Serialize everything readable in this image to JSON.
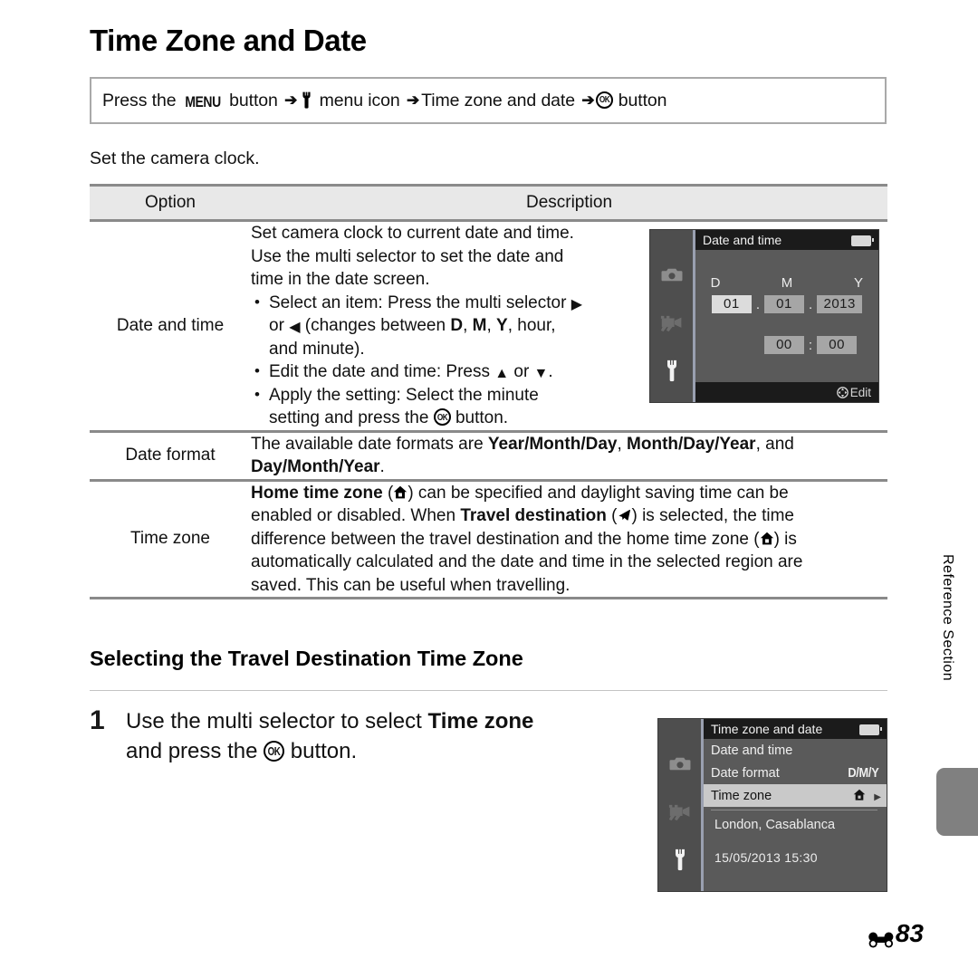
{
  "document": {
    "title": "Time Zone and Date",
    "nav": {
      "parts": [
        "Press the ",
        "MENU",
        " button ",
        "menu icon",
        "Time zone and date",
        " button"
      ],
      "press_the": "Press the ",
      "menu_label": "MENU",
      "button_word": " button ",
      "menu_icon_word": " menu icon ",
      "item": "Time zone and date",
      "ok_button_word": " button"
    },
    "intro": "Set the camera clock.",
    "side_label": "Reference Section",
    "page_number": "83"
  },
  "table": {
    "headers": {
      "option": "Option",
      "description": "Description"
    },
    "rows": [
      {
        "option": "Date and time",
        "lines": [
          "Set camera clock to current date and time.",
          "Use the multi selector to set the date and",
          "time in the date screen."
        ],
        "bullets": [
          {
            "lines": [
              "Select an item: Press the multi selector ▶",
              "or ◀ (changes between D, M, Y, hour,",
              "and minute)."
            ]
          },
          {
            "lines": [
              "Edit the date and time: Press ▲ or ▼."
            ]
          },
          {
            "lines": [
              "Apply the setting: Select the minute",
              "setting and press the OK button."
            ]
          }
        ]
      },
      {
        "option": "Date format",
        "text_parts": {
          "p1": "The available date formats are ",
          "b1": "Year/Month/Day",
          "p2": ", ",
          "b2": "Month/Day/Year",
          "p3": ", and",
          "b3": "Day/Month/Year",
          "p4": "."
        }
      },
      {
        "option": "Time zone",
        "text_parts": {
          "b1": "Home time zone",
          "p1": " (",
          "p2": ") can be specified and daylight saving time can be",
          "p3": "enabled or disabled. When ",
          "b2": "Travel destination",
          "p4": " (",
          "p5": ") is selected, the time",
          "p6": "difference between the travel destination and the home time zone (",
          "p7": ") is",
          "p8": "automatically calculated and the date and time in the selected region are",
          "p9": "saved. This can be useful when travelling."
        }
      }
    ]
  },
  "section": {
    "heading": "Selecting the Travel Destination Time Zone",
    "step_number": "1",
    "step_text_1": "Use the multi selector to select ",
    "step_text_bold": "Time zone",
    "step_text_2": "and press the ",
    "step_text_3": " button."
  },
  "lcd_date_screen": {
    "title": "Date and time",
    "labels": {
      "d": "D",
      "m": "M",
      "y": "Y"
    },
    "values": {
      "day": "01",
      "month": "01",
      "year": "2013",
      "hour": "00",
      "minute": "00"
    },
    "separators": {
      "date": ".",
      "time": ":"
    },
    "footer": "Edit",
    "rail_icons": [
      "camera-icon",
      "movie-icon",
      "wrench-icon"
    ]
  },
  "lcd_menu_screen": {
    "title": "Time zone and date",
    "items": [
      {
        "label": "Date and time",
        "value": "",
        "active": false
      },
      {
        "label": "Date format",
        "value": "D/M/Y",
        "active": false
      },
      {
        "label": "Time zone",
        "value": "",
        "active": true
      }
    ],
    "info_city": "London, Casablanca",
    "info_datetime": "15/05/2013  15:30",
    "rail_icons": [
      "camera-icon",
      "movie-icon",
      "wrench-icon"
    ]
  },
  "colors": {
    "rule": "#8a8a8a",
    "header_bg": "#e8e8e8",
    "lcd_bg": "#5a5a5a",
    "lcd_rail": "#4e4e4e",
    "lcd_title_bg": "#1b1b1b",
    "highlight": "#c9c9c9",
    "side_tab": "#808080"
  }
}
